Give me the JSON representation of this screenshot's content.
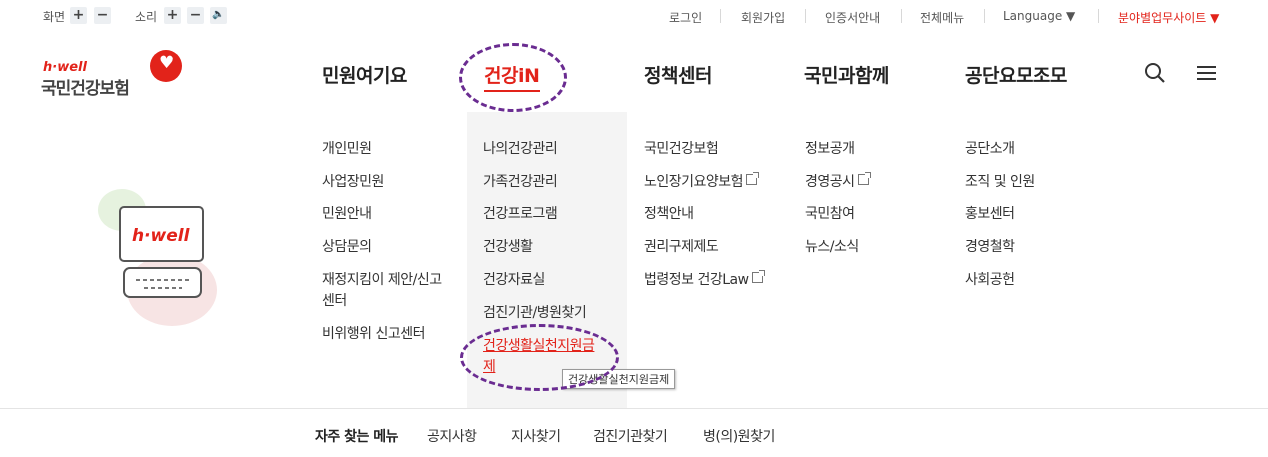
{
  "utility": {
    "screen_label": "화면",
    "sound_label": "소리",
    "plus": "+",
    "minus": "−",
    "speaker": "🔈",
    "links": [
      "로그인",
      "회원가입",
      "인증서안내",
      "전체메뉴"
    ],
    "language": "Language ▼",
    "related_sites": "분야별업무사이트 ▼"
  },
  "logo": {
    "brand": "h·well",
    "name": "국민건강보험",
    "heart": "♥"
  },
  "gnb": {
    "items": [
      "민원여기요",
      "건강iN",
      "정책센터",
      "국민과함께",
      "공단요모조모"
    ],
    "active_index": 1,
    "search_icon": "search-icon",
    "menu_icon": "hamburger-icon"
  },
  "megamenu": {
    "col1": [
      "개인민원",
      "사업장민원",
      "민원안내",
      "상담문의",
      "재정지킴이 제안/신고",
      "센터",
      "비위행위 신고센터"
    ],
    "col2": [
      "나의건강관리",
      "가족건강관리",
      "건강프로그램",
      "건강생활",
      "건강자료실",
      "검진기관/병원찾기",
      "건강생활실천지원금",
      "제"
    ],
    "col3": [
      "국민건강보험",
      "노인장기요양보험",
      "정책안내",
      "권리구제제도",
      "법령정보 건강Law"
    ],
    "col4": [
      "정보공개",
      "경영공시",
      "국민참여",
      "뉴스/소식"
    ],
    "col5": [
      "공단소개",
      "조직 및 인원",
      "홍보센터",
      "경영철학",
      "사회공헌"
    ],
    "tooltip": "건강생활실천지원금제"
  },
  "illustration": {
    "screen_text": "h·well"
  },
  "quick": {
    "title": "자주 찾는 메뉴",
    "items": [
      "공지사항",
      "지사찾기",
      "검진기관찾기",
      "병(의)원찾기"
    ]
  },
  "colors": {
    "accent": "#e2231a",
    "annotation": "#6a2c91",
    "column_bg": "#f4f4f4"
  }
}
